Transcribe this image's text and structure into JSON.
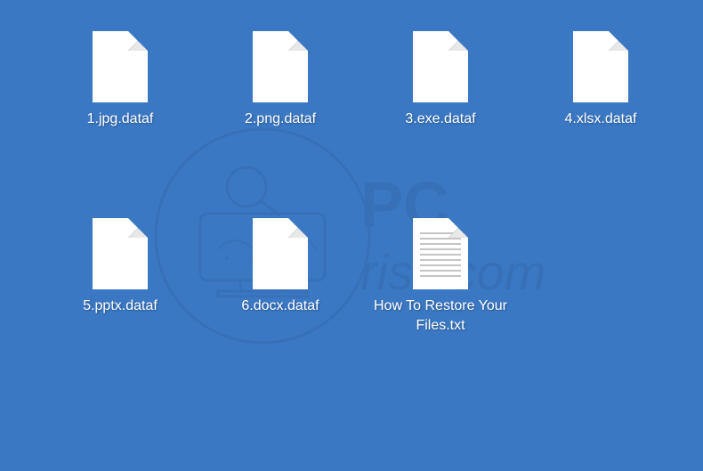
{
  "files": [
    {
      "name": "1.jpg.dataf",
      "type": "blank"
    },
    {
      "name": "2.png.dataf",
      "type": "blank"
    },
    {
      "name": "3.exe.dataf",
      "type": "blank"
    },
    {
      "name": "4.xlsx.dataf",
      "type": "blank"
    },
    {
      "name": "5.pptx.dataf",
      "type": "blank"
    },
    {
      "name": "6.docx.dataf",
      "type": "blank"
    },
    {
      "name": "How To Restore Your Files.txt",
      "type": "text"
    }
  ],
  "watermark_text": "PCrisk.com"
}
